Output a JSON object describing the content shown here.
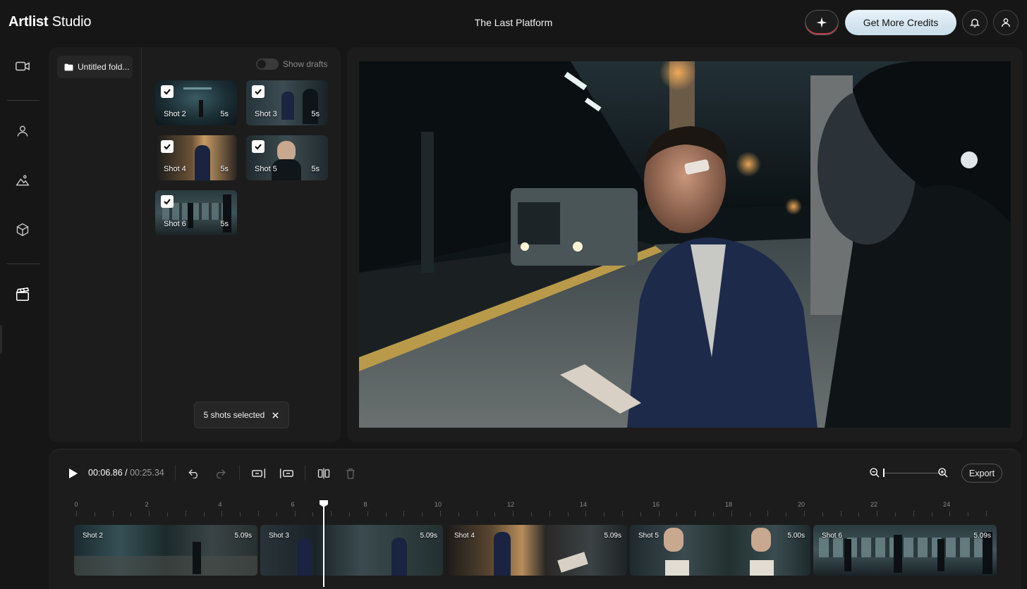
{
  "header": {
    "brand_bold": "Artlist",
    "brand_light": "Studio",
    "project_title": "The Last Platform",
    "credits_button": "Get More Credits",
    "sparkle_icon": "sparkle-icon",
    "bell_icon": "bell-icon",
    "user_icon": "user-icon"
  },
  "rail": {
    "items": [
      {
        "icon": "video-camera-icon"
      },
      {
        "icon": "person-icon"
      },
      {
        "icon": "landscape-icon"
      },
      {
        "icon": "cube-icon"
      },
      {
        "icon": "clapperboard-icon",
        "active": true
      }
    ]
  },
  "library": {
    "folder_label": "Untitled fold...",
    "show_drafts_label": "Show drafts",
    "show_drafts_on": false,
    "shots": [
      {
        "label": "Shot 2",
        "duration": "5s",
        "checked": true
      },
      {
        "label": "Shot 3",
        "duration": "5s",
        "checked": true
      },
      {
        "label": "Shot 4",
        "duration": "5s",
        "checked": true
      },
      {
        "label": "Shot 5",
        "duration": "5s",
        "checked": true
      },
      {
        "label": "Shot 6",
        "duration": "5s",
        "checked": true
      }
    ],
    "selection_text": "5 shots selected"
  },
  "timeline": {
    "current_time": "00:06.86",
    "separator": " / ",
    "total_time": "00:25.34",
    "export_label": "Export",
    "zoom_level": 0,
    "ruler_labels": [
      "0",
      "2",
      "4",
      "6",
      "8",
      "10",
      "12",
      "14",
      "16",
      "18",
      "20",
      "22",
      "24"
    ],
    "clips": [
      {
        "label": "Shot 2",
        "duration": "5.09s"
      },
      {
        "label": "Shot 3",
        "duration": "5.09s"
      },
      {
        "label": "Shot 4",
        "duration": "5.09s"
      },
      {
        "label": "Shot 5",
        "duration": "5.00s"
      },
      {
        "label": "Shot 6",
        "duration": "5.09s"
      }
    ]
  },
  "colors": {
    "background": "#161616",
    "panel": "#1c1c1c",
    "accent_credits": "#d6e8f3"
  }
}
